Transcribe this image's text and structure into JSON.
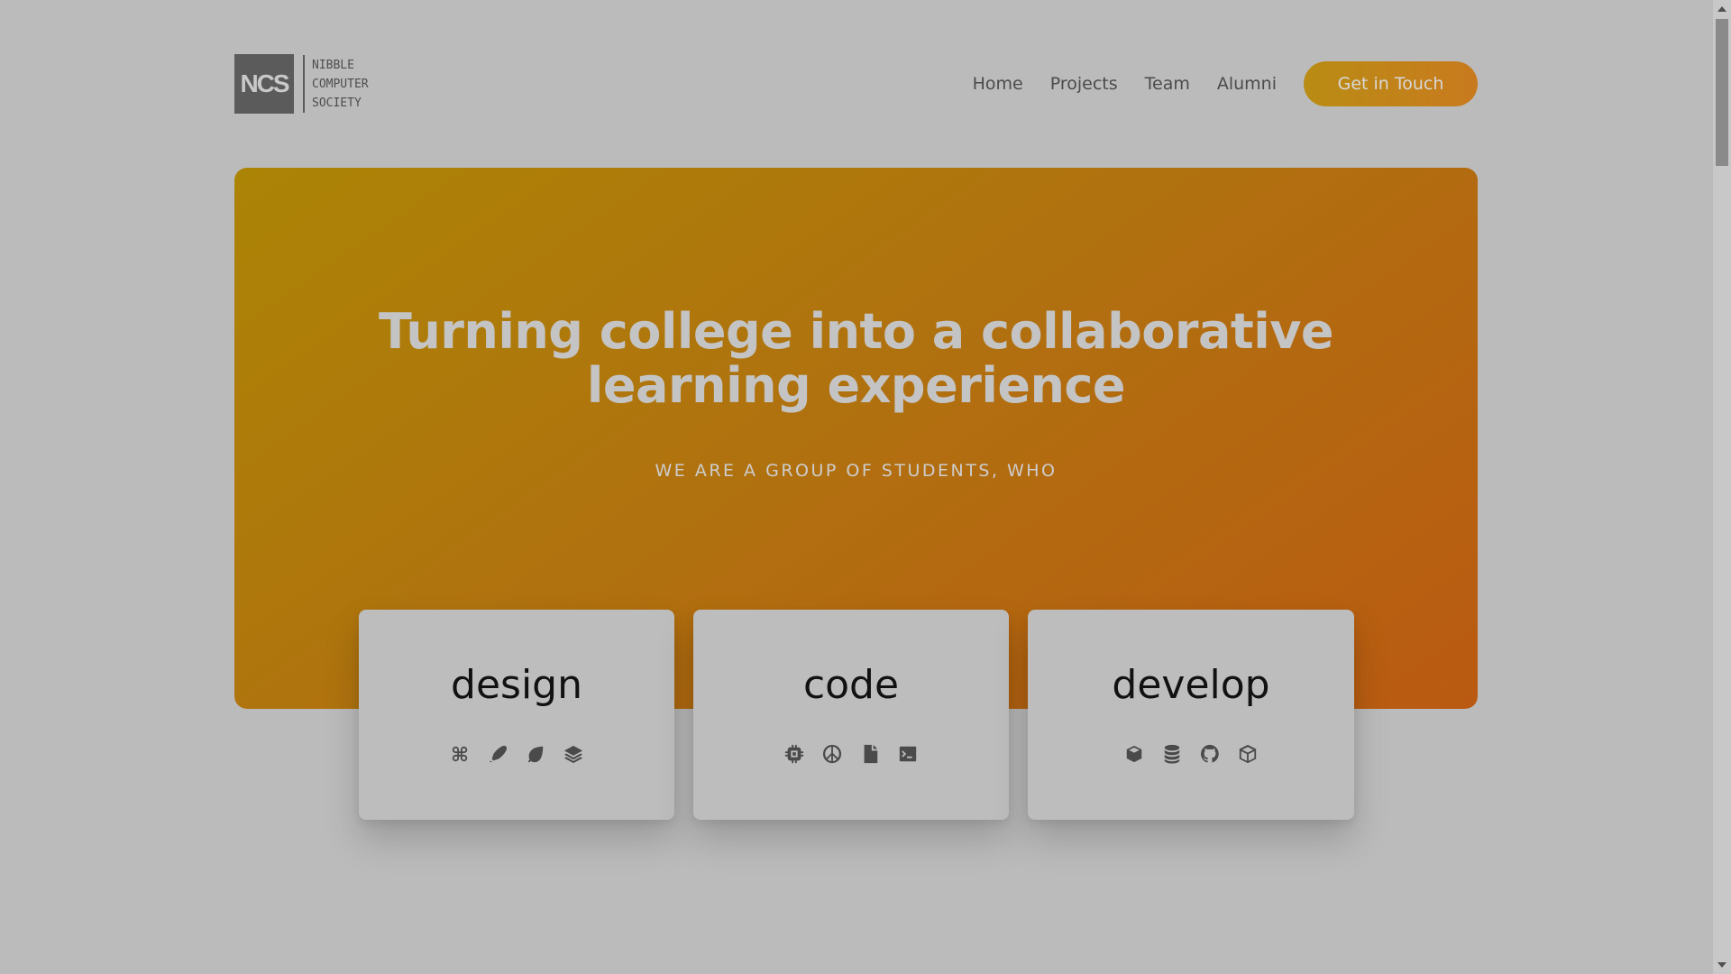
{
  "logo": {
    "mark": "NCS",
    "lines": [
      "NIBBLE",
      "COMPUTER",
      "SOCIETY"
    ]
  },
  "nav": {
    "links": [
      "Home",
      "Projects",
      "Team",
      "Alumni"
    ],
    "cta": "Get in Touch"
  },
  "hero": {
    "title_line1": "Turning college into a collaborative",
    "title_line2": "learning experience",
    "subtitle": "WE ARE A GROUP OF STUDENTS, WHO"
  },
  "cards": [
    {
      "title": "design",
      "icons": [
        "command-icon",
        "pen-icon",
        "leaf-icon",
        "layers-icon"
      ]
    },
    {
      "title": "code",
      "icons": [
        "chip-icon",
        "peace-icon",
        "file-icon",
        "terminal-icon"
      ]
    },
    {
      "title": "develop",
      "icons": [
        "box-icon",
        "database-icon",
        "github-icon",
        "cube-icon"
      ]
    }
  ],
  "colors": {
    "hero_start": "#ac8405",
    "hero_end": "#ba5a12",
    "cta": "#b98c14",
    "background": "#bbbbbb"
  }
}
